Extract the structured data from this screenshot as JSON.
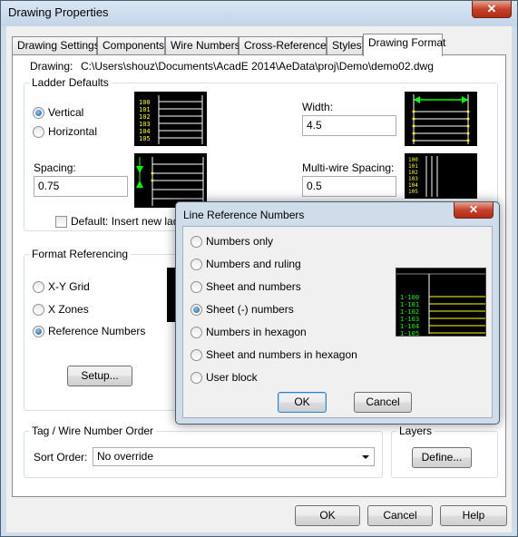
{
  "window": {
    "title": "Drawing Properties",
    "close_glyph": "✕"
  },
  "tabs": [
    {
      "label": "Drawing Settings"
    },
    {
      "label": "Components"
    },
    {
      "label": "Wire Numbers"
    },
    {
      "label": "Cross-References"
    },
    {
      "label": "Styles"
    },
    {
      "label": "Drawing Format",
      "active": true
    }
  ],
  "drawing": {
    "label": "Drawing:",
    "path": "C:\\Users\\shouz\\Documents\\AcadE 2014\\AeData\\proj\\Demo\\demo02.dwg"
  },
  "ladder_defaults": {
    "title": "Ladder Defaults",
    "vertical": "Vertical",
    "horizontal": "Horizontal",
    "spacing_label": "Spacing:",
    "spacing_value": "0.75",
    "width_label": "Width:",
    "width_value": "4.5",
    "multiwire_label": "Multi-wire Spacing:",
    "multiwire_value": "0.5",
    "default_insert_label": "Default: Insert new ladde",
    "preview_numbers": [
      "100",
      "101",
      "102",
      "103",
      "104",
      "105"
    ]
  },
  "format_referencing": {
    "title": "Format Referencing",
    "xy_grid": "X-Y Grid",
    "x_zones": "X Zones",
    "reference_numbers": "Reference Numbers",
    "setup_button": "Setup..."
  },
  "tag_order": {
    "title": "Tag / Wire Number Order",
    "sort_label": "Sort Order:",
    "sort_value": "No override"
  },
  "layers": {
    "title": "Layers",
    "define_button": "Define..."
  },
  "footer": {
    "ok": "OK",
    "cancel": "Cancel",
    "help": "Help"
  },
  "line_ref_dialog": {
    "title": "Line Reference Numbers",
    "close_glyph": "✕",
    "options": [
      {
        "label": "Numbers only",
        "selected": false
      },
      {
        "label": "Numbers and ruling",
        "selected": false
      },
      {
        "label": "Sheet and numbers",
        "selected": false
      },
      {
        "label": "Sheet (-) numbers",
        "selected": true
      },
      {
        "label": "Numbers in hexagon",
        "selected": false
      },
      {
        "label": "Sheet and numbers in hexagon",
        "selected": false
      },
      {
        "label": "User block",
        "selected": false
      }
    ],
    "preview_labels": [
      "1-100",
      "1-101",
      "1-102",
      "1-103",
      "1-104",
      "1-105"
    ],
    "ok": "OK",
    "cancel": "Cancel"
  },
  "colors": {
    "preview_bg": "#000000",
    "preview_text": "#ffff00",
    "preview_accent": "#00ff00",
    "dialog_frame": "#cfdcea"
  }
}
